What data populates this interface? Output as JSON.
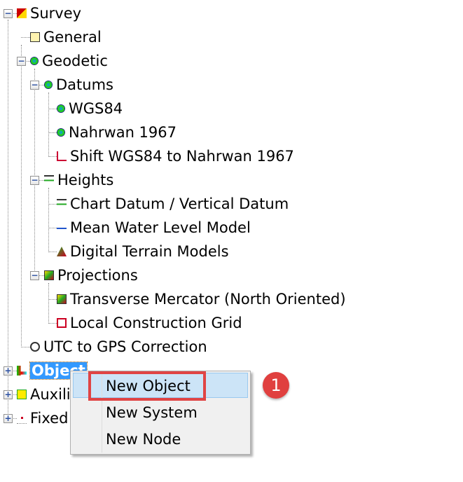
{
  "tree": [
    {
      "label": "Survey",
      "icon": "survey-icon",
      "toggle": "−"
    },
    {
      "label": "General",
      "icon": "general-icon"
    },
    {
      "label": "Geodetic",
      "icon": "geodetic-icon",
      "toggle": "−"
    },
    {
      "label": "Datums",
      "icon": "globe-icon",
      "toggle": "−"
    },
    {
      "label": "WGS84",
      "icon": "globe-icon"
    },
    {
      "label": "Nahrwan 1967",
      "icon": "globe-icon"
    },
    {
      "label": "Shift WGS84 to Nahrwan 1967",
      "icon": "axes-icon"
    },
    {
      "label": "Heights",
      "icon": "heights-icon",
      "toggle": "−"
    },
    {
      "label": "Chart Datum / Vertical Datum",
      "icon": "heights-icon"
    },
    {
      "label": "Mean Water Level Model",
      "icon": "water-level-icon"
    },
    {
      "label": "Digital Terrain Models",
      "icon": "terrain-icon"
    },
    {
      "label": "Projections",
      "icon": "projection-icon",
      "toggle": "−"
    },
    {
      "label": "Transverse Mercator (North Oriented)",
      "icon": "projection-icon"
    },
    {
      "label": "Local Construction Grid",
      "icon": "grid-icon"
    },
    {
      "label": "UTC to GPS Correction",
      "icon": "stopwatch-icon"
    },
    {
      "label": "Object",
      "icon": "object-icon",
      "toggle": "+"
    },
    {
      "label": "Auxili",
      "icon": "auxiliary-icon",
      "toggle": "+"
    },
    {
      "label": "Fixed",
      "icon": "fixed-icon",
      "toggle": "+"
    }
  ],
  "menu": {
    "items": [
      "New Object",
      "New System",
      "New Node"
    ]
  },
  "badge": "1",
  "colors": {
    "selection": "#3399ff",
    "highlight_box": "#e04444",
    "badge": "#e0403f"
  }
}
